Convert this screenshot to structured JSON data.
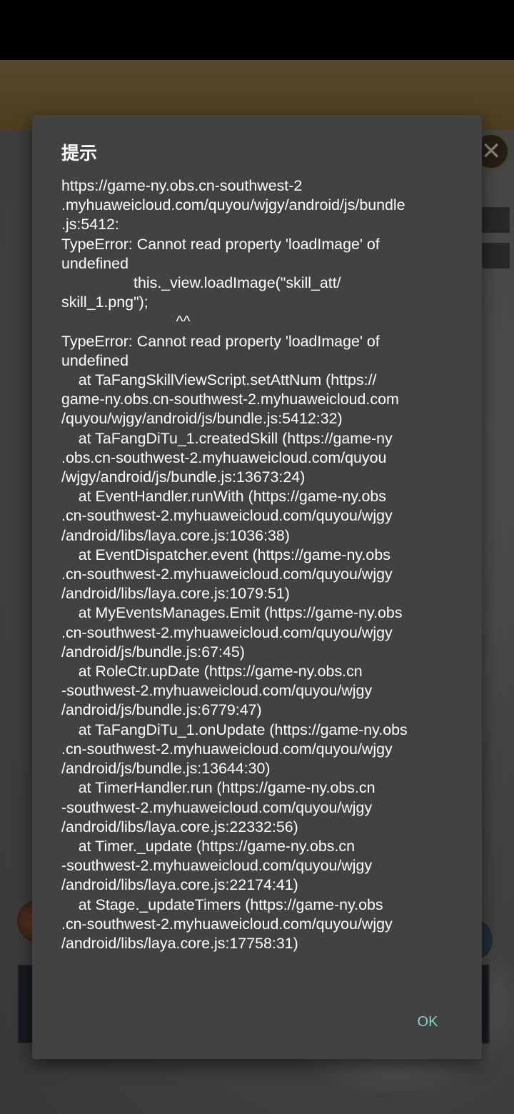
{
  "background": {
    "close_glyph": "✕",
    "accent_gold": "#8a7446"
  },
  "dialog": {
    "title": "提示",
    "message_lines": [
      "https://game-ny.obs.cn-southwest-2",
      ".myhuaweicloud.com/quyou/wjgy/android/js/bundle",
      ".js:5412:",
      "TypeError: Cannot read property 'loadImage' of",
      "undefined",
      "                 this._view.loadImage(\"skill_att/",
      "skill_1.png\");",
      "                           ^^",
      "TypeError: Cannot read property 'loadImage' of",
      "undefined",
      "    at TaFangSkillViewScript.setAttNum (https://",
      "game-ny.obs.cn-southwest-2.myhuaweicloud.com",
      "/quyou/wjgy/android/js/bundle.js:5412:32)",
      "    at TaFangDiTu_1.createdSkill (https://game-ny",
      ".obs.cn-southwest-2.myhuaweicloud.com/quyou",
      "/wjgy/android/js/bundle.js:13673:24)",
      "    at EventHandler.runWith (https://game-ny.obs",
      ".cn-southwest-2.myhuaweicloud.com/quyou/wjgy",
      "/android/libs/laya.core.js:1036:38)",
      "    at EventDispatcher.event (https://game-ny.obs",
      ".cn-southwest-2.myhuaweicloud.com/quyou/wjgy",
      "/android/libs/laya.core.js:1079:51)",
      "    at MyEventsManages.Emit (https://game-ny.obs",
      ".cn-southwest-2.myhuaweicloud.com/quyou/wjgy",
      "/android/js/bundle.js:67:45)",
      "    at RoleCtr.upDate (https://game-ny.obs.cn",
      "-southwest-2.myhuaweicloud.com/quyou/wjgy",
      "/android/js/bundle.js:6779:47)",
      "    at TaFangDiTu_1.onUpdate (https://game-ny.obs",
      ".cn-southwest-2.myhuaweicloud.com/quyou/wjgy",
      "/android/js/bundle.js:13644:30)",
      "    at TimerHandler.run (https://game-ny.obs.cn",
      "-southwest-2.myhuaweicloud.com/quyou/wjgy",
      "/android/libs/laya.core.js:22332:56)",
      "    at Timer._update (https://game-ny.obs.cn",
      "-southwest-2.myhuaweicloud.com/quyou/wjgy",
      "/android/libs/laya.core.js:22174:41)",
      "    at Stage._updateTimers (https://game-ny.obs",
      ".cn-southwest-2.myhuaweicloud.com/quyou/wjgy",
      "/android/libs/laya.core.js:17758:31)"
    ],
    "ok_label": "OK",
    "accent_color": "#7fd6cd",
    "surface_color": "#424242"
  }
}
